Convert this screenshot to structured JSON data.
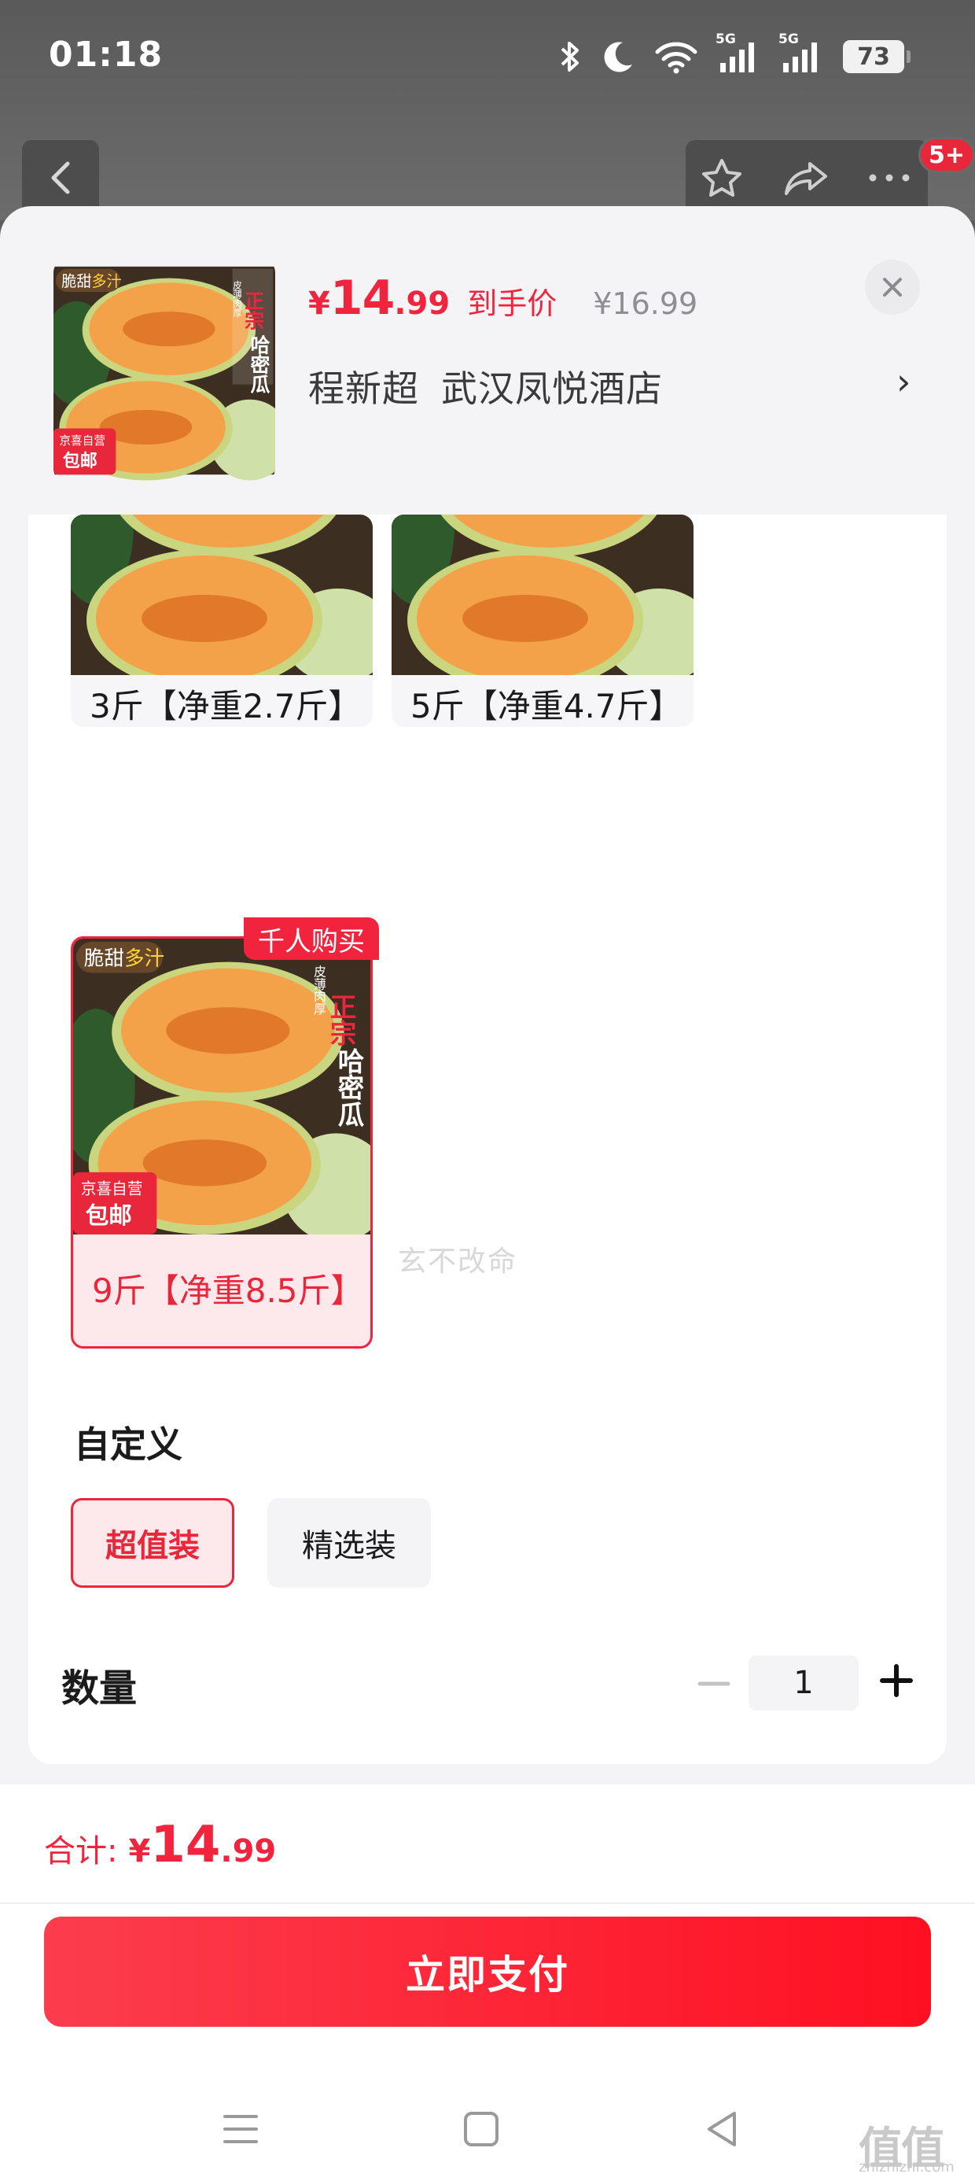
{
  "status_bar": {
    "time": "01:18",
    "network_tag_1": "5G",
    "network_tag_2": "5G",
    "battery": "73"
  },
  "top_bar": {
    "cart_badge": "5+"
  },
  "product": {
    "price_currency": "¥",
    "price_int": "14",
    "price_dec": ".99",
    "price_label": "到手价",
    "original_price": "¥16.99",
    "address_name": "程新超",
    "address_place": "武汉凤悦酒店",
    "address_chevron": "›"
  },
  "thumbnail": {
    "tag_crisp": "脆甜",
    "tag_juicy": "多汁",
    "tag_thin": "皮薄肉厚",
    "tag_authentic": "正宗",
    "tag_name": "哈密瓜",
    "tag_store": "京喜自营",
    "tag_shipping": "包邮"
  },
  "specs": [
    {
      "label": "3斤【净重2.7斤】",
      "selected": false
    },
    {
      "label": "5斤【净重4.7斤】",
      "selected": false
    },
    {
      "label": "9斤【净重8.5斤】",
      "selected": true,
      "badge": "千人购买"
    }
  ],
  "watermark": "玄不改命",
  "custom": {
    "title": "自定义",
    "options": [
      {
        "label": "超值装",
        "selected": true
      },
      {
        "label": "精选装",
        "selected": false
      }
    ]
  },
  "quantity": {
    "label": "数量",
    "value": "1"
  },
  "total": {
    "label": "合计:",
    "currency": "¥",
    "int": "14",
    "dec": ".99"
  },
  "pay_button": "立即支付",
  "site_watermark": {
    "logo": "值值值",
    "url": "zhizhizhi.com"
  },
  "colors": {
    "accent": "#f2233c",
    "selected_bg": "#fde8ec",
    "pay_gradient_start": "#fb3d4d",
    "pay_gradient_end": "#fe1022"
  },
  "icons": [
    "bluetooth-icon",
    "moon-icon",
    "wifi-icon",
    "signal-icon",
    "back-arrow-icon",
    "star-icon",
    "share-icon",
    "more-icon",
    "close-icon",
    "minus-icon",
    "plus-icon",
    "menu-icon",
    "home-icon",
    "back-triangle-icon"
  ]
}
